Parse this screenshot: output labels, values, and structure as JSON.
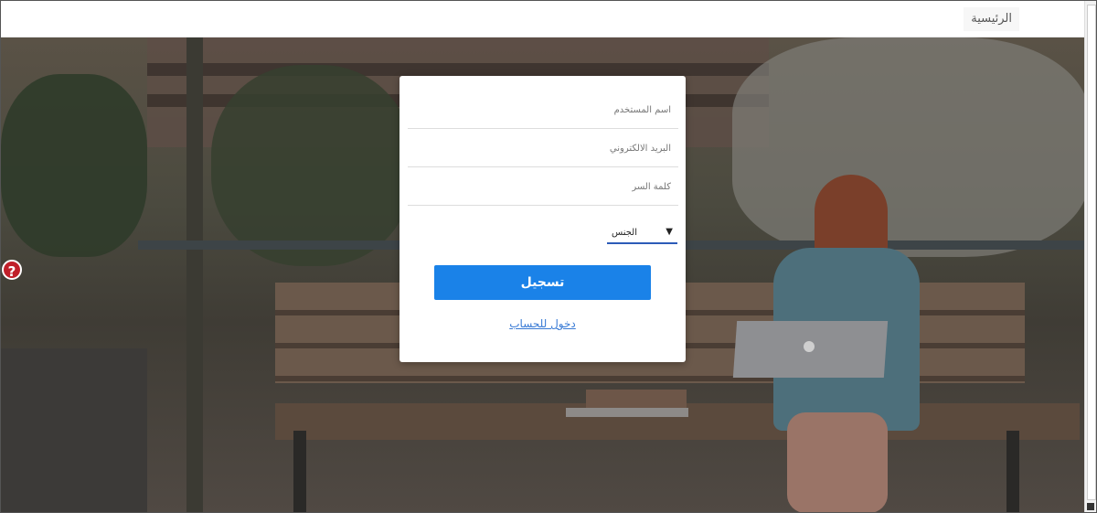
{
  "navbar": {
    "home_label": "الرئيسية"
  },
  "form": {
    "username_placeholder": "اسم المستخدم",
    "email_placeholder": "البريد الالكتروني",
    "password_placeholder": "كلمة السر",
    "gender_label": "الجنس",
    "gender_caret": "▼",
    "register_label": "تسجيل",
    "login_link": "دخول للحساب"
  },
  "help": {
    "icon": "question-icon",
    "glyph": "?"
  },
  "colors": {
    "primary": "#1a82e8",
    "link": "#3a7bd5",
    "help": "#c0202a"
  }
}
